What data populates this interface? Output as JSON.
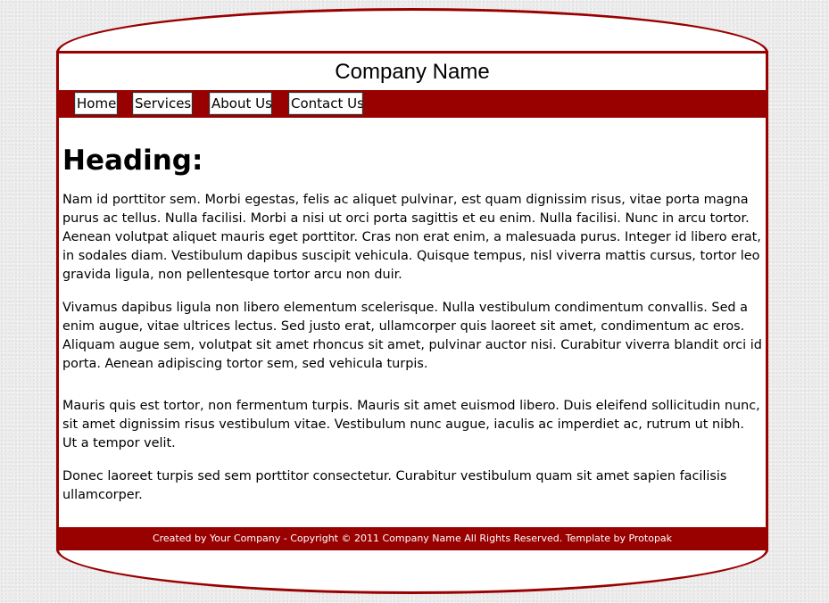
{
  "header": {
    "company_name": "Company Name"
  },
  "nav": {
    "items": [
      {
        "label": "Home"
      },
      {
        "label": "Services"
      },
      {
        "label": "About Us"
      },
      {
        "label": "Contact Us"
      }
    ]
  },
  "main": {
    "heading": "Heading:",
    "paragraphs": [
      "Nam id porttitor sem. Morbi egestas, felis ac aliquet pulvinar, est quam dignissim risus, vitae porta magna purus ac tellus. Nulla facilisi. Morbi a nisi ut orci porta sagittis et eu enim. Nulla facilisi. Nunc in arcu tortor. Aenean volutpat aliquet mauris eget porttitor. Cras non erat enim, a malesuada purus. Integer id libero erat, in sodales diam. Vestibulum dapibus suscipit vehicula. Quisque tempus, nisl viverra mattis cursus, tortor leo gravida ligula, non pellentesque tortor arcu non duir.",
      "Vivamus dapibus ligula non libero elementum scelerisque. Nulla vestibulum condimentum convallis. Sed a enim augue, vitae ultrices lectus. Sed justo erat, ullamcorper quis laoreet sit amet, condimentum ac eros. Aliquam augue sem, volutpat sit amet rhoncus sit amet, pulvinar auctor nisi. Curabitur viverra blandit orci id porta. Aenean adipiscing tortor sem, sed vehicula turpis.",
      "Mauris quis est tortor, non fermentum turpis. Mauris sit amet euismod libero. Duis eleifend sollicitudin nunc, sit amet dignissim risus vestibulum vitae. Vestibulum nunc augue, iaculis ac imperdiet ac, rutrum ut nibh. Ut a tempor velit.",
      "Donec laoreet turpis sed sem porttitor consectetur. Curabitur vestibulum quam sit amet sapien facilisis ullamcorper."
    ]
  },
  "footer": {
    "text": "Created by Your Company - Copyright © 2011 Company Name All Rights Reserved.  Template by Protopak"
  },
  "colors": {
    "accent": "#990000",
    "background": "#ececec",
    "panel": "#ffffff"
  }
}
